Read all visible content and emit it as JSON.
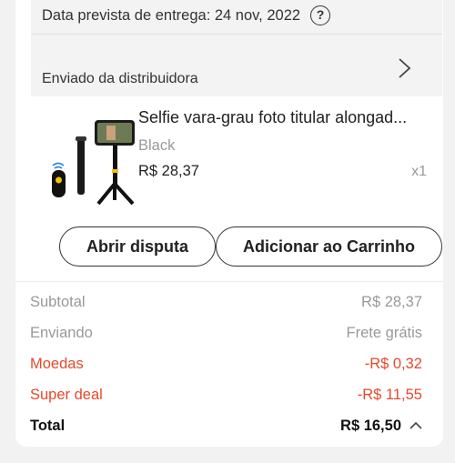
{
  "delivery": {
    "estimated_text": "Data prevista de entrega: 24 nov, 2022",
    "help_glyph": "?",
    "shipper_text": "Enviado da distribuidora"
  },
  "product": {
    "title": "Selfie vara-grau foto titular alongad...",
    "variant": "Black",
    "price": "R$ 28,37",
    "quantity": "x1"
  },
  "actions": {
    "dispute_label": "Abrir disputa",
    "add_to_cart_label": "Adicionar ao Carrinho"
  },
  "summary": {
    "subtotal_label": "Subtotal",
    "subtotal_value": "R$ 28,37",
    "shipping_label": "Enviando",
    "shipping_value": "Frete grátis",
    "coins_label": "Moedas",
    "coins_value": "-R$ 0,32",
    "superdeal_label": "Super deal",
    "superdeal_value": "-R$ 11,55",
    "total_label": "Total",
    "total_value": "R$ 16,50"
  },
  "colors": {
    "discount": "#e8482b",
    "muted": "#999999",
    "background": "#f2f2f2"
  },
  "icons": [
    "help-circle-icon",
    "chevron-right-icon",
    "chevron-up-icon"
  ]
}
